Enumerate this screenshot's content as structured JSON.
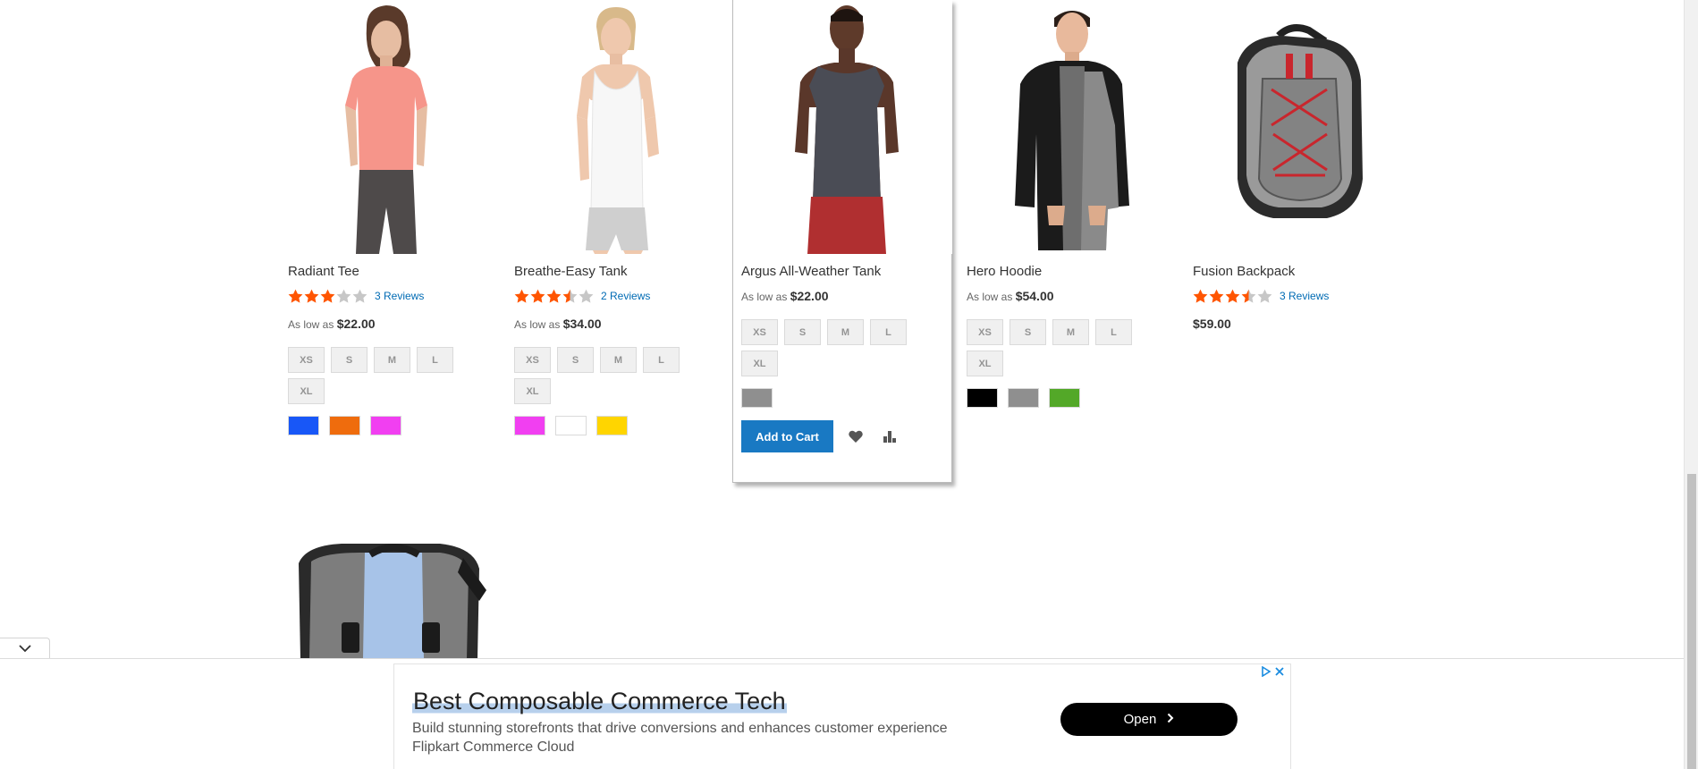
{
  "products": [
    {
      "name": "Radiant Tee",
      "rating_fraction": 0.6,
      "reviews": "3 Reviews",
      "price_prefix": "As low as",
      "price": "$22.00",
      "sizes": [
        "XS",
        "S",
        "M",
        "L",
        "XL"
      ],
      "swatch_colors": [
        "#1857f7",
        "#ef6c0d",
        "#f13ff1"
      ]
    },
    {
      "name": "Breathe-Easy Tank",
      "rating_fraction": 0.7,
      "reviews": "2 Reviews",
      "price_prefix": "As low as",
      "price": "$34.00",
      "sizes": [
        "XS",
        "S",
        "M",
        "L",
        "XL"
      ],
      "swatch_colors": [
        "#f13ff1",
        "#ffffff",
        "#ffd500"
      ]
    },
    {
      "name": "Argus All-Weather Tank",
      "price_prefix": "As low as",
      "price": "$22.00",
      "sizes": [
        "XS",
        "S",
        "M",
        "L",
        "XL"
      ],
      "swatch_colors": [
        "#8f8f8f"
      ],
      "add_to_cart": "Add to Cart"
    },
    {
      "name": "Hero Hoodie",
      "price_prefix": "As low as",
      "price": "$54.00",
      "sizes": [
        "XS",
        "S",
        "M",
        "L",
        "XL"
      ],
      "swatch_colors": [
        "#000000",
        "#8f8f8f",
        "#53a828"
      ]
    },
    {
      "name": "Fusion Backpack",
      "rating_fraction": 0.7,
      "reviews": "3 Reviews",
      "price": "$59.00"
    }
  ],
  "ad": {
    "title": "Best Composable Commerce Tech",
    "description": "Build stunning storefronts that drive conversions and enhances customer experience",
    "advertiser": "Flipkart Commerce Cloud",
    "cta": "Open"
  },
  "colors": {
    "star_filled": "#ff5501",
    "star_empty": "#c7c7c7",
    "link": "#006bb4",
    "primary_button": "#1979c3"
  },
  "icons": [
    "star-icon",
    "heart-icon",
    "compare-icon",
    "chevron-down-icon",
    "chevron-right-icon",
    "adchoices-icon",
    "close-icon"
  ]
}
